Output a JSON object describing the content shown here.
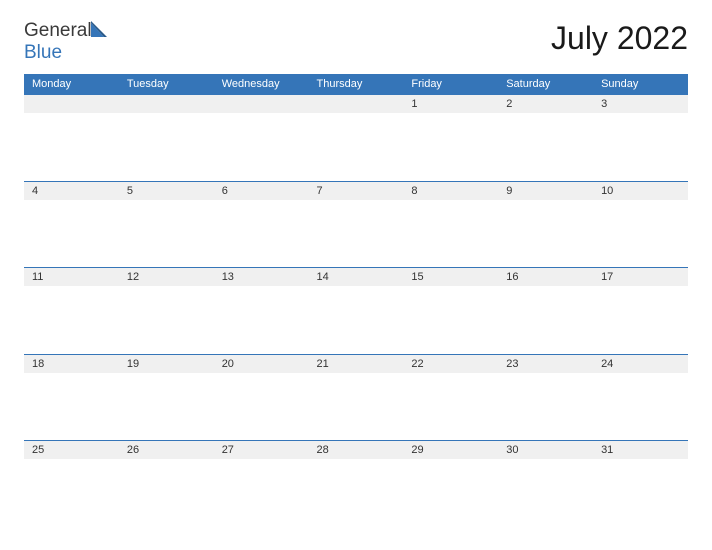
{
  "logo": {
    "word1": "General",
    "word2": "Blue"
  },
  "title": "July 2022",
  "headers": [
    "Monday",
    "Tuesday",
    "Wednesday",
    "Thursday",
    "Friday",
    "Saturday",
    "Sunday"
  ],
  "weeks": [
    [
      "",
      "",
      "",
      "",
      "1",
      "2",
      "3"
    ],
    [
      "4",
      "5",
      "6",
      "7",
      "8",
      "9",
      "10"
    ],
    [
      "11",
      "12",
      "13",
      "14",
      "15",
      "16",
      "17"
    ],
    [
      "18",
      "19",
      "20",
      "21",
      "22",
      "23",
      "24"
    ],
    [
      "25",
      "26",
      "27",
      "28",
      "29",
      "30",
      "31"
    ]
  ]
}
